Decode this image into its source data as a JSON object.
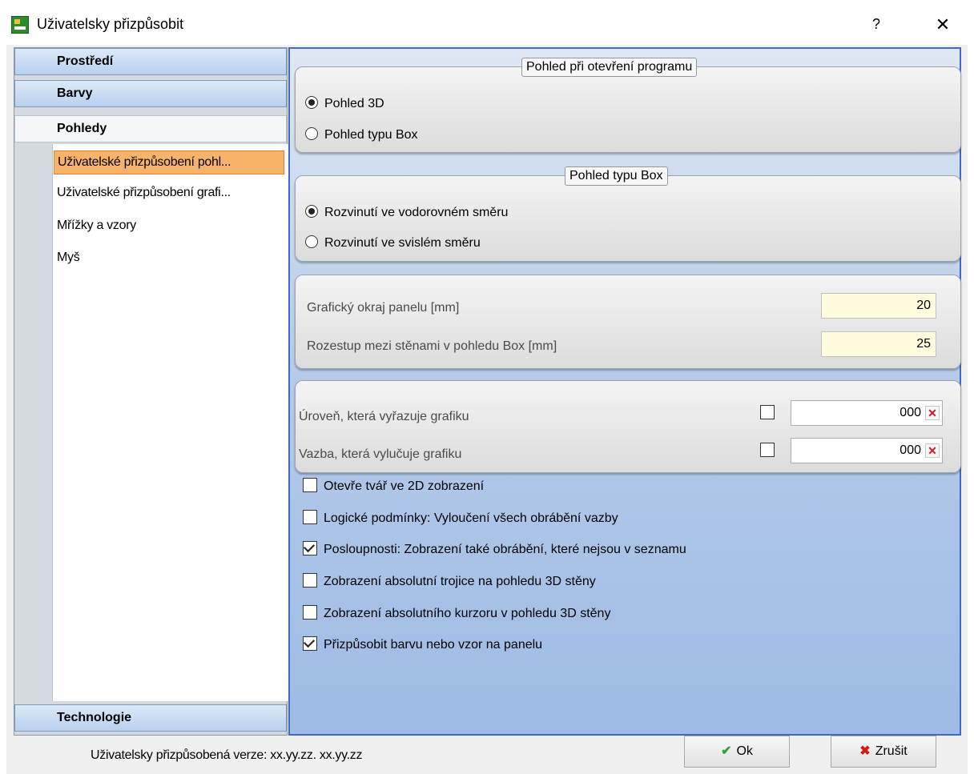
{
  "window": {
    "title": "Uživatelsky přizpůsobit",
    "help_label": "?",
    "close_label": "✕"
  },
  "nav": {
    "sections": {
      "prostredi": "Prostředí",
      "barvy": "Barvy",
      "pohledy": "Pohledy",
      "technologie": "Technologie"
    },
    "items": [
      {
        "label": "Uživatelské přizpůsobení pohl...",
        "selected": true
      },
      {
        "label": "Uživatelské přizpůsobení grafi...",
        "selected": false
      },
      {
        "label": "Mřížky a vzory",
        "selected": false
      },
      {
        "label": "Myš",
        "selected": false
      }
    ]
  },
  "group_view_open": {
    "legend": "Pohled při otevření programu",
    "options": [
      {
        "label": "Pohled 3D",
        "checked": true
      },
      {
        "label": "Pohled typu Box",
        "checked": false
      }
    ]
  },
  "group_box_view": {
    "legend": "Pohled typu Box",
    "options": [
      {
        "label": "Rozvinutí ve vodorovném směru",
        "checked": true
      },
      {
        "label": "Rozvinutí ve svislém směru",
        "checked": false
      }
    ]
  },
  "group_dimensions": {
    "fields": [
      {
        "label": "Grafický okraj panelu [mm]",
        "value": "20"
      },
      {
        "label": "Rozestup mezi stěnami v pohledu Box [mm]",
        "value": "25"
      }
    ]
  },
  "group_exclusion": {
    "fields": [
      {
        "label": "Úroveň, která vyřazuje grafiku",
        "checked": false,
        "value": "000"
      },
      {
        "label": "Vazba, která vylučuje grafiku",
        "checked": false,
        "value": "000"
      }
    ],
    "clear_label": "✕"
  },
  "options": [
    {
      "label": "Otevře tvář ve 2D zobrazení",
      "checked": false
    },
    {
      "label": "Logické podmínky: Vyloučení všech obrábění vazby",
      "checked": false
    },
    {
      "label": "Posloupnosti: Zobrazení také obrábění, které nejsou v seznamu",
      "checked": true
    },
    {
      "label": "Zobrazení absolutní trojice na pohledu 3D stěny",
      "checked": false
    },
    {
      "label": "Zobrazení absolutního kurzoru v pohledu 3D stěny",
      "checked": false
    },
    {
      "label": "Přizpůsobit barvu nebo vzor na panelu",
      "checked": true
    }
  ],
  "footer": {
    "version_text": "Uživatelsky přizpůsobená verze: xx.yy.zz. xx.yy.zz",
    "ok_label": "Ok",
    "cancel_label": "Zrušit",
    "ok_icon": "checkmark-icon",
    "cancel_icon": "red-x-icon"
  },
  "colors": {
    "selected_item": "#f8b36b",
    "panel_border": "#4169c4",
    "numeric_field": "#fffbdc"
  }
}
